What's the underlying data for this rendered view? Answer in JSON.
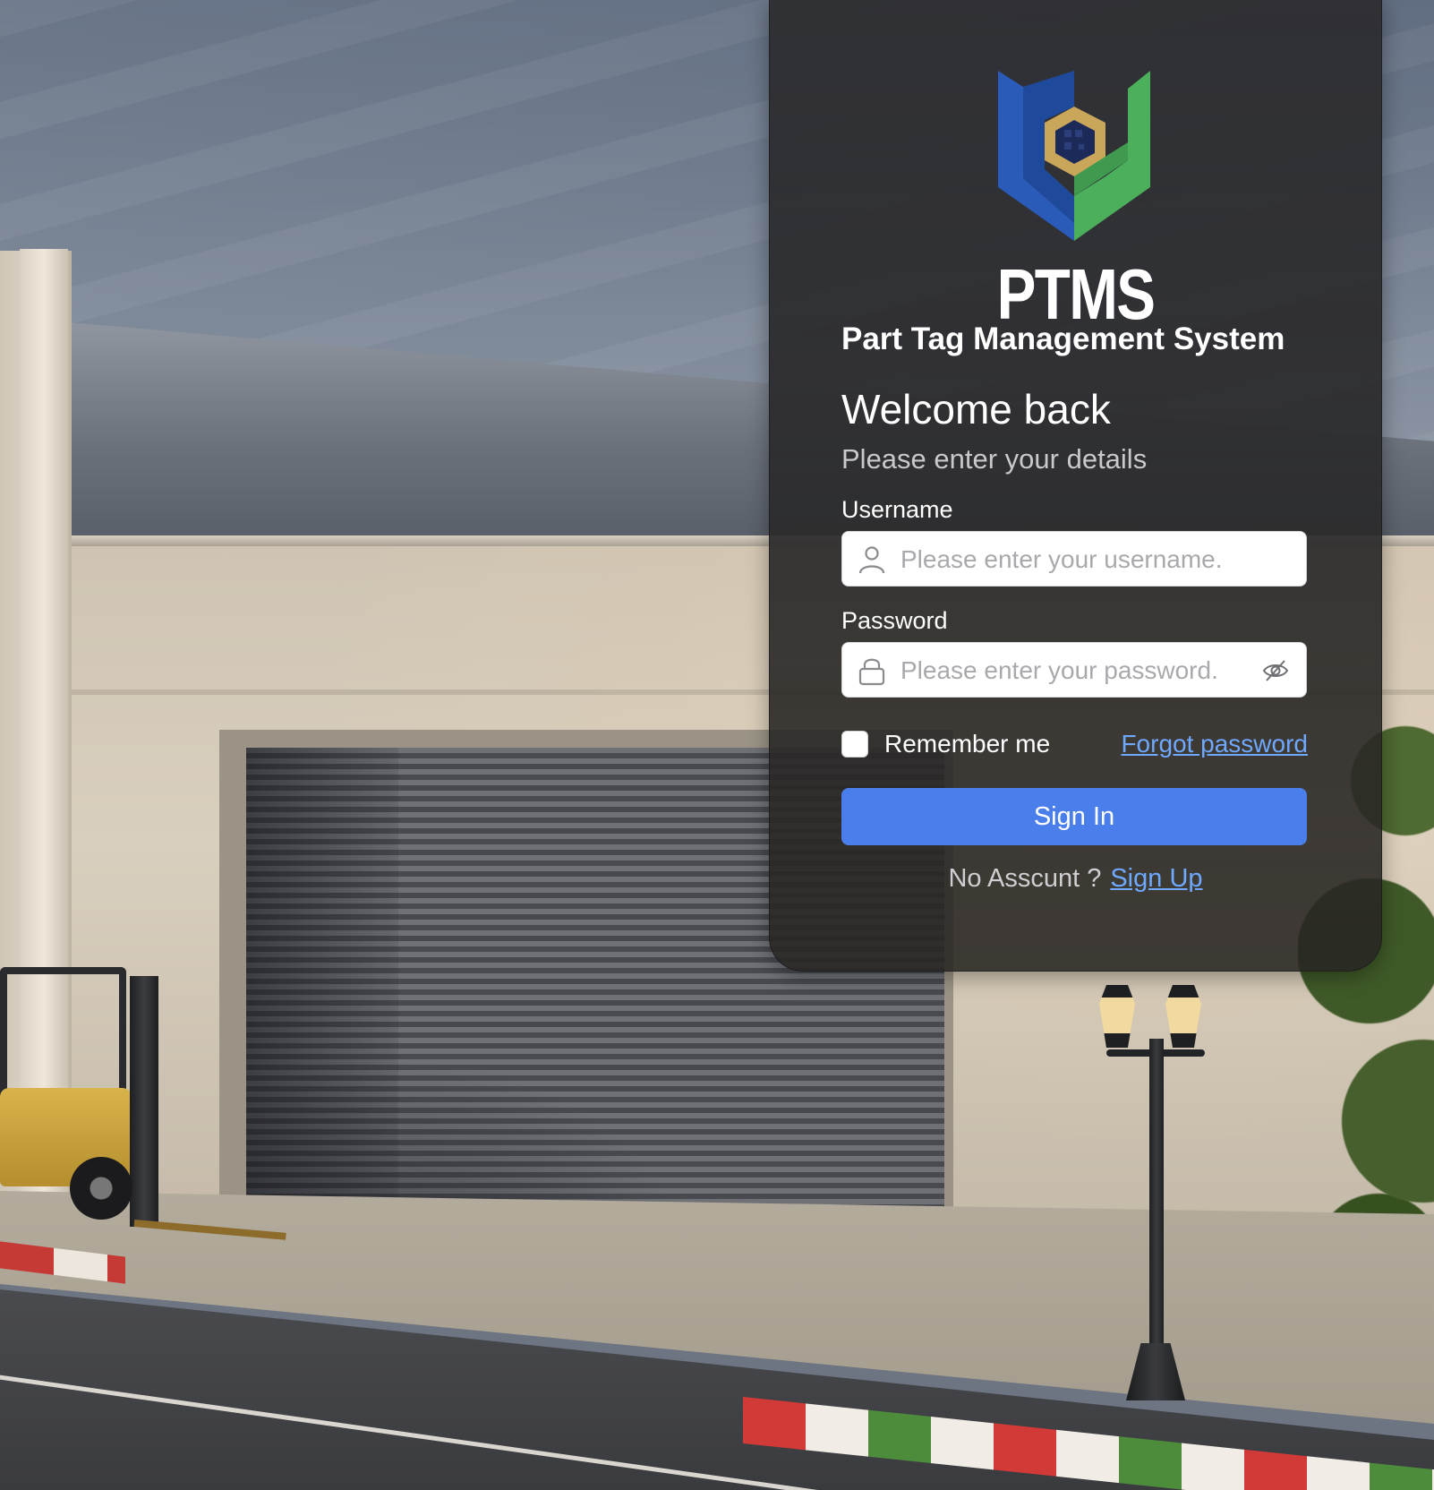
{
  "brand": {
    "acronym": "PTMS",
    "full_name": "Part Tag Management System",
    "logo_icon": "ptms-shield-logo"
  },
  "login": {
    "heading": "Welcome back",
    "subheading": "Please enter your details",
    "username": {
      "label": "Username",
      "placeholder": "Please enter your username.",
      "value": "",
      "icon": "user-icon"
    },
    "password": {
      "label": "Password",
      "placeholder": "Please enter your password.",
      "value": "",
      "icon": "lock-icon",
      "toggle_icon": "eye-off-icon"
    },
    "remember_label": "Remember me",
    "remember_checked": false,
    "forgot_label": "Forgot password",
    "signin_label": "Sign In",
    "no_account_text": "No Asscunt ?",
    "signup_label": "Sign Up"
  },
  "colors": {
    "primary_button": "#4a7eea",
    "link": "#6ea8ff",
    "card_bg": "#2e2f33",
    "logo_blue": "#2a5bb8",
    "logo_green": "#4caf5c",
    "logo_gold": "#c9a65a"
  }
}
